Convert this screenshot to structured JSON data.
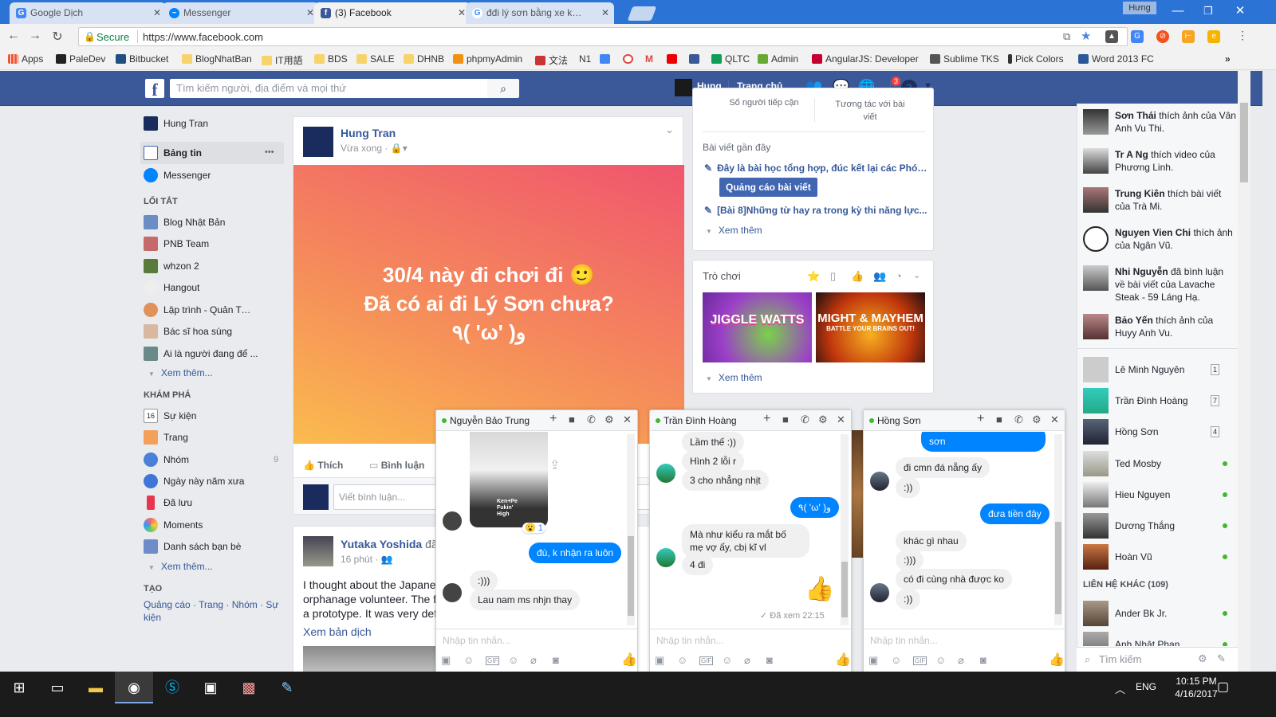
{
  "browser": {
    "tabs": [
      {
        "label": "Google Dịch",
        "icon_color": "#4285f4"
      },
      {
        "label": "Messenger",
        "icon_color": "#0084ff"
      },
      {
        "label": "(3) Facebook",
        "icon_color": "#3b5998"
      },
      {
        "label": "đđi lý sơn bằng xe khách",
        "icon_color": "#4285f4"
      }
    ],
    "user_badge": "Hưng",
    "secure_label": "Secure",
    "url": "https://www.facebook.com",
    "bookmarks": [
      "Apps",
      "PaleDev",
      "Bitbucket",
      "BlogNhatBan",
      "IT用語",
      "BDS",
      "SALE",
      "DHNB",
      "phpmyAdmin",
      "文法",
      "N1",
      "QLTC",
      "Admin",
      "AngularJS: Developer",
      "Sublime TKS",
      "Pick Colors",
      "Word 2013 FC"
    ]
  },
  "fb": {
    "search_placeholder": "Tìm kiếm người, địa điểm và mọi thứ",
    "user": "Hung",
    "home": "Trang chủ",
    "notif_count": "3",
    "brand_color": "#3b5998"
  },
  "left": {
    "profile": "Hung Tran",
    "newsfeed": "Bảng tin",
    "more_dots": "•••",
    "messenger": "Messenger",
    "shortcuts_title": "LỐI TẮT",
    "shortcuts": [
      "Blog Nhật Bản",
      "PNB Team",
      "whzon 2",
      "Hangout",
      "Lập trình - Quản Trị - ...",
      "Bác sĩ hoa súng",
      "Ai là người đang để ..."
    ],
    "see_more": "Xem thêm...",
    "explore_title": "KHÁM PHÁ",
    "explore": [
      {
        "label": "Sự kiện",
        "count": ""
      },
      {
        "label": "Trang",
        "count": ""
      },
      {
        "label": "Nhóm",
        "count": "9"
      },
      {
        "label": "Ngày này năm xưa",
        "count": ""
      },
      {
        "label": "Đã lưu",
        "count": ""
      },
      {
        "label": "Moments",
        "count": ""
      },
      {
        "label": "Danh sách bạn bè",
        "count": ""
      }
    ],
    "see_more2": "Xem thêm...",
    "create_title": "TẠO",
    "create_links": "Quảng cáo · Trang · Nhóm · Sự kiện"
  },
  "post1": {
    "author": "Hung Tran",
    "time": "Vừa xong",
    "text_line1": "30/4 này đi chơi đi 🙂",
    "text_line2": "Đã có ai đi Lý Sơn chưa?",
    "text_line3": "٩( 'ω' )و",
    "like": "Thích",
    "comment": "Bình luận",
    "comment_placeholder": "Viết bình luận..."
  },
  "post2": {
    "author": "Yutaka Yoshida",
    "author_suffix": "đã",
    "time": "16 phút",
    "line1": "I thought about the Japane",
    "line2": "orphanage volunteer. The f",
    "line3": "a prototype. It was very def",
    "translate": "Xem bản dịch"
  },
  "page_panel": {
    "top_left": "Số người tiếp cận",
    "top_right1": "Tương tác với bài",
    "top_right2": "viết",
    "recent_title": "Bài viết gần đây",
    "recent1": "Đây là bài học tổng hợp, đúc kết lại các Phó ...",
    "promote": "Quảng cáo bài viết",
    "recent2": "[Bài 8]Những từ hay ra trong kỳ thi năng lực...",
    "see_more": "Xem thêm"
  },
  "games": {
    "title": "Trò chơi",
    "game1": "JIGGLE WATTS",
    "game2a": "MIGHT & MAYHEM",
    "game2b": "BATTLE YOUR BRAINS OUT!",
    "see_more": "Xem thêm"
  },
  "ticker": [
    {
      "name": "Sơn Thái",
      "text": " thích ảnh của Vân Anh Vu Thi."
    },
    {
      "name": "Tr A Ng",
      "text": " thích video của Phương Linh."
    },
    {
      "name": "Trung Kiên",
      "text": " thích bài viết của Trà Mi."
    },
    {
      "name": "Nguyen Vien Chi",
      "text": " thích ảnh của Ngân Vũ."
    },
    {
      "name": "Nhi Nguyễn",
      "text": " đã bình luận về bài viết của Lavache Steak - 59 Láng Hạ."
    },
    {
      "name": "Bảo Yến",
      "text": " thích ảnh của Huyy Anh Vu."
    }
  ],
  "contacts": [
    {
      "name": "Lê Minh Nguyên",
      "count": "1"
    },
    {
      "name": "Trần Đình Hoàng",
      "count": "7"
    },
    {
      "name": "Hồng Sơn",
      "count": "4"
    },
    {
      "name": "Ted Mosby",
      "count": ""
    },
    {
      "name": "Hieu Nguyen",
      "count": ""
    },
    {
      "name": "Dương Thắng",
      "count": ""
    },
    {
      "name": "Hoàn Vũ",
      "count": ""
    }
  ],
  "other_contacts_title": "LIÊN HỆ KHÁC (109)",
  "other_contacts": [
    "Ander Bk Jr.",
    "Anh Nhật Phan"
  ],
  "chat_search": "Tìm kiếm",
  "chat1": {
    "name": "Nguyễn Bảo Trung",
    "reaction": "😮 1",
    "photo_caption": "Ken+Pe Fukin' High",
    "msgs": [
      "đù, k nhận ra luôn",
      ":)))",
      "Lau nam ms nhjn thay"
    ],
    "input": "Nhập tin nhắn..."
  },
  "chat2": {
    "name": "Trần Đình Hoàng",
    "msgs": [
      "Lầm thế :))",
      "Hình 2 lỗi r",
      "3 cho nhẳng nhịt",
      "٩( 'ω' )و",
      "Mà như kiểu ra mắt bố mẹ vợ ấy, cbị kĩ vl",
      "4 đi"
    ],
    "seen": "✓ Đã xem 22:15",
    "input": "Nhập tin nhắn..."
  },
  "chat3": {
    "name": "Hồng Sơn",
    "msgs": [
      "sơn",
      "đi cmn đá nẵng ấy",
      ":))",
      "đưa tiền đây",
      "khác gì nhau",
      ":)))",
      "có đi cùng nhà được ko",
      ":))"
    ],
    "input": "Nhập tin nhắn..."
  },
  "taskbar": {
    "lang": "ENG",
    "time": "10:15 PM",
    "date": "4/16/2017"
  }
}
